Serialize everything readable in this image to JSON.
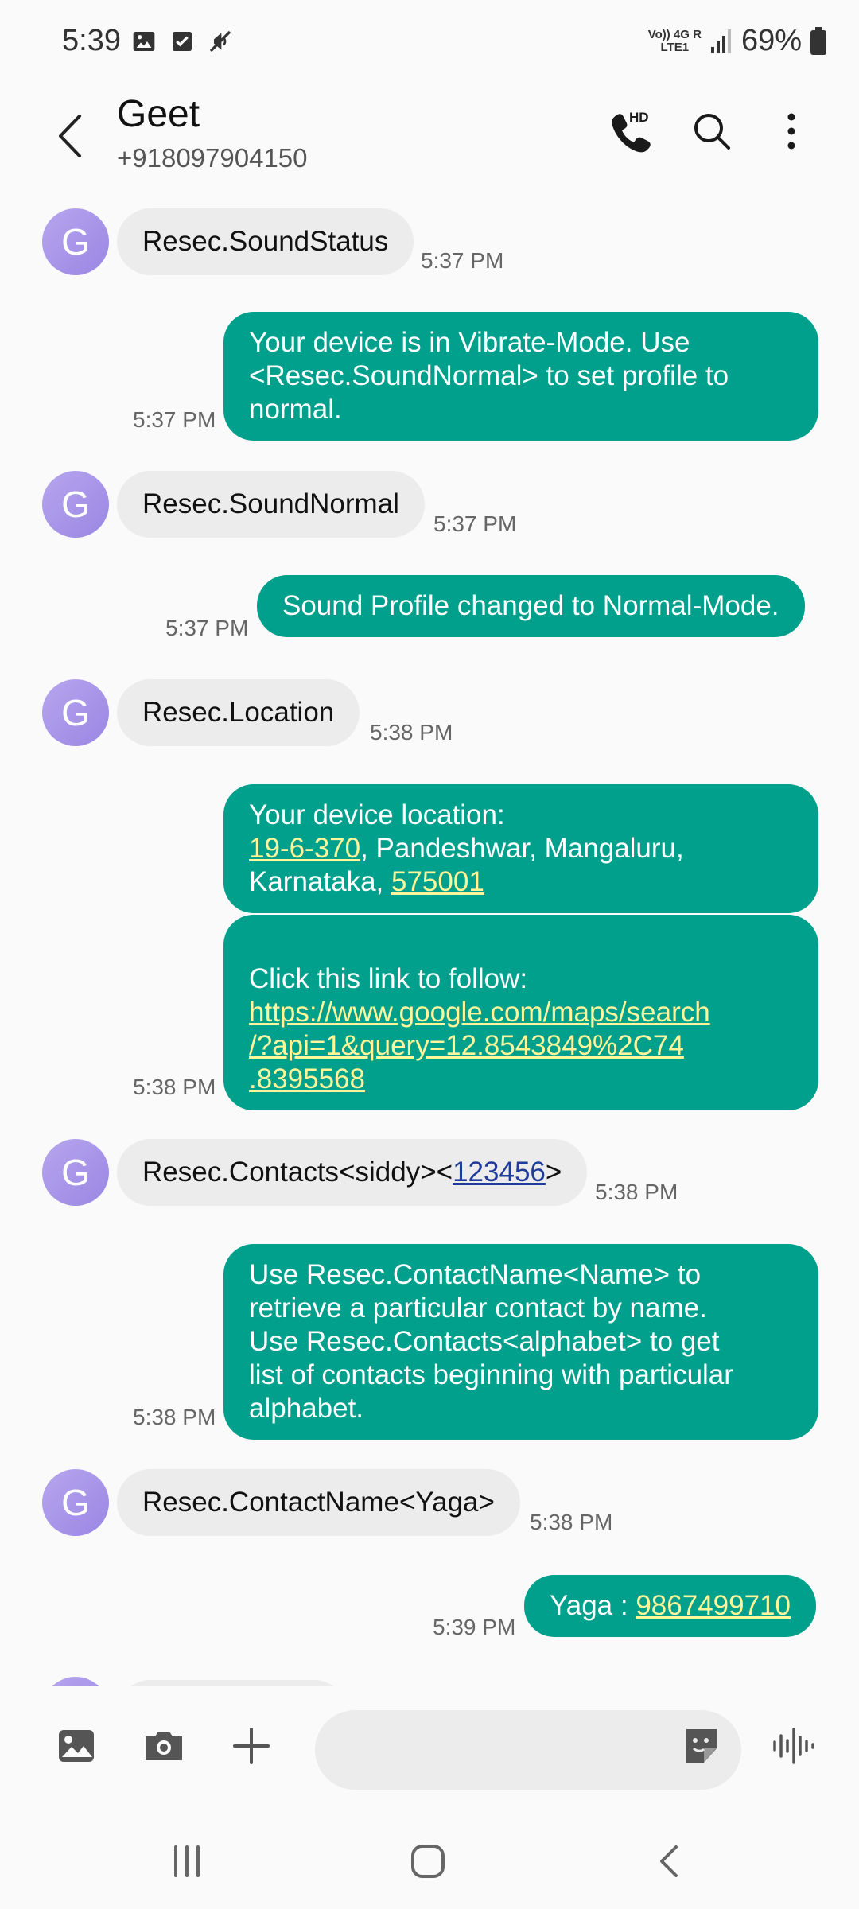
{
  "status_bar": {
    "time": "5:39",
    "network_top": "Vo)) 4G R",
    "network_bottom": "LTE1",
    "battery": "69%"
  },
  "header": {
    "contact_name": "Geet",
    "contact_number": "+918097904150",
    "avatar_letter": "G"
  },
  "messages": [
    {
      "dir": "in",
      "text": "Resec.SoundStatus",
      "time": "5:37 PM"
    },
    {
      "dir": "out",
      "lines": [
        "Your device is in Vibrate-Mode. Use",
        "<Resec.SoundNormal> to set profile to",
        "normal."
      ],
      "time": "5:37 PM"
    },
    {
      "dir": "in",
      "text": "Resec.SoundNormal",
      "time": "5:37 PM"
    },
    {
      "dir": "out",
      "text": "Sound Profile changed to Normal-Mode.",
      "time": "5:37 PM"
    },
    {
      "dir": "in",
      "text": "Resec.Location",
      "time": "5:38 PM"
    },
    {
      "dir": "out",
      "line1": "Your device location:",
      "link1": "19-6-370",
      "mid": ", Pandeshwar, Mangaluru,",
      "line3": "Karnataka, ",
      "link2": "575001"
    },
    {
      "dir": "out",
      "line1": "Click this link to follow:",
      "link_lines": [
        "https://www.google.com/maps/search",
        "/?api=1&query=12.8543849%2C74",
        ".8395568"
      ],
      "time": "5:38 PM"
    },
    {
      "dir": "in",
      "prefix": "Resec.Contacts<siddy><",
      "link": "123456",
      "suffix": ">",
      "time": "5:38 PM"
    },
    {
      "dir": "out",
      "lines": [
        "Use Resec.ContactName<Name> to",
        "retrieve a particular contact by name.",
        "Use Resec.Contacts<alphabet> to get",
        "list of contacts beginning with particular",
        "alphabet."
      ],
      "time": "5:38 PM"
    },
    {
      "dir": "in",
      "text": "Resec.ContactName<Yaga>",
      "time": "5:38 PM"
    },
    {
      "dir": "out",
      "prefix": "Yaga : ",
      "link": "9867499710",
      "time": "5:39 PM"
    }
  ],
  "input": {
    "placeholder": ""
  },
  "colors": {
    "outgoing_bubble": "#00a08c",
    "incoming_bubble": "#ececec",
    "avatar": "#a896e8",
    "link_outgoing": "#fff59a",
    "link_incoming": "#1f3c9a"
  },
  "icons": [
    "gallery-icon",
    "checkbox-icon",
    "mute-icon",
    "back-arrow-icon",
    "hd-call-icon",
    "search-icon",
    "more-options-icon",
    "image-icon",
    "camera-icon",
    "plus-icon",
    "sticker-icon",
    "voice-wave-icon",
    "recents-nav-icon",
    "home-nav-icon",
    "back-nav-icon"
  ]
}
